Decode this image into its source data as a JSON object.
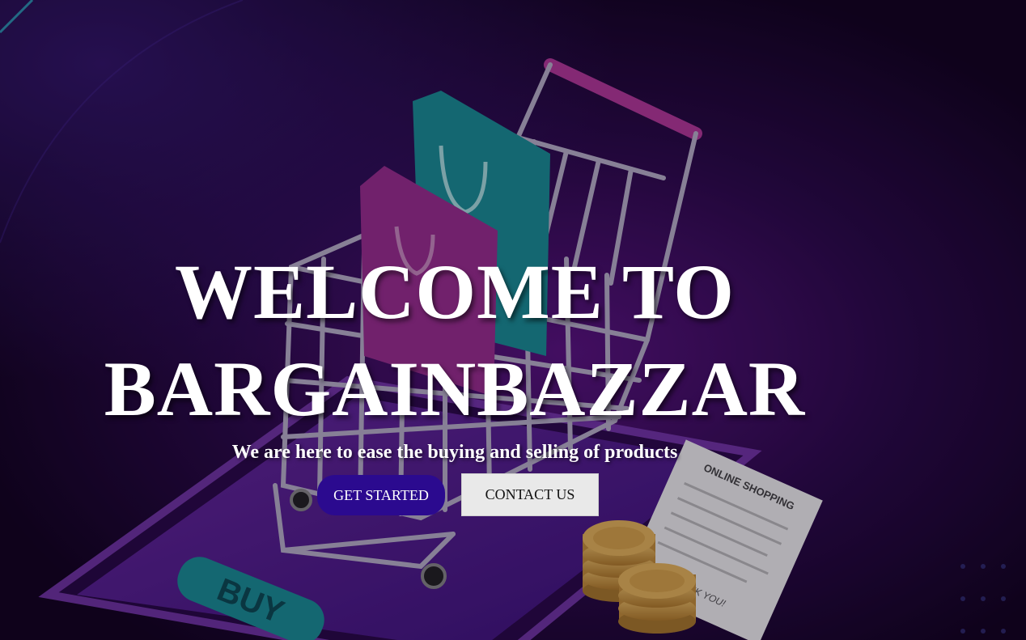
{
  "hero": {
    "headline_line1": "WELCOME TO",
    "headline_line2": "BARGAINBAZZAR",
    "tagline": "We are here to ease the buying and selling of products",
    "get_started_label": "GET STARTED",
    "contact_label": "CONTACT US"
  },
  "background": {
    "phone_button_label": "BUY",
    "receipt_heading": "ONLINE SHOPPING",
    "receipt_footer": "THANK YOU!"
  },
  "colors": {
    "background": "#150525",
    "accent_purple": "#2b0a8f",
    "bag_teal": "#1a8f96",
    "bag_magenta": "#9a2f8f",
    "coin_gold": "#d9a64a"
  },
  "icons": [
    "shopping-cart-illustration",
    "shopping-bag-icon",
    "smartphone-illustration",
    "receipt-illustration",
    "coin-stack-icon"
  ]
}
